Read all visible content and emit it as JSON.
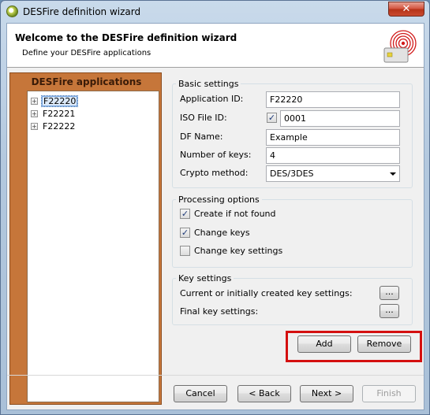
{
  "window": {
    "title": "DESFire definition wizard",
    "close_glyph": "✕"
  },
  "header": {
    "title": "Welcome to the DESFire definition wizard",
    "subtitle": "Define your DESFire applications"
  },
  "applications_panel": {
    "title": "DESFire applications",
    "items": [
      {
        "label": "F22220",
        "selected": true
      },
      {
        "label": "F22221",
        "selected": false
      },
      {
        "label": "F22222",
        "selected": false
      }
    ],
    "expander_glyph": "+"
  },
  "basic_settings": {
    "title": "Basic settings",
    "application_id_label": "Application ID:",
    "application_id_value": "F22220",
    "iso_file_id_label": "ISO File ID:",
    "iso_file_id_checked": true,
    "iso_file_id_value": "0001",
    "df_name_label": "DF Name:",
    "df_name_value": "Example",
    "number_of_keys_label": "Number of keys:",
    "number_of_keys_value": "4",
    "crypto_method_label": "Crypto method:",
    "crypto_method_value": "DES/3DES"
  },
  "processing_options": {
    "title": "Processing options",
    "create_if_not_found_label": "Create if not found",
    "create_if_not_found_checked": true,
    "change_keys_label": "Change keys",
    "change_keys_checked": true,
    "change_key_settings_label": "Change key settings",
    "change_key_settings_checked": false
  },
  "key_settings": {
    "title": "Key settings",
    "current_label": "Current or initially created key settings:",
    "final_label": "Final key settings:",
    "browse_label": "..."
  },
  "actions": {
    "add_label": "Add",
    "remove_label": "Remove"
  },
  "footer": {
    "cancel_label": "Cancel",
    "back_label": "< Back",
    "next_label": "Next >",
    "finish_label": "Finish"
  },
  "checkmark_glyph": "✓",
  "colors": {
    "panel_orange": "#c6763a",
    "highlight_red": "#d40f0f"
  }
}
